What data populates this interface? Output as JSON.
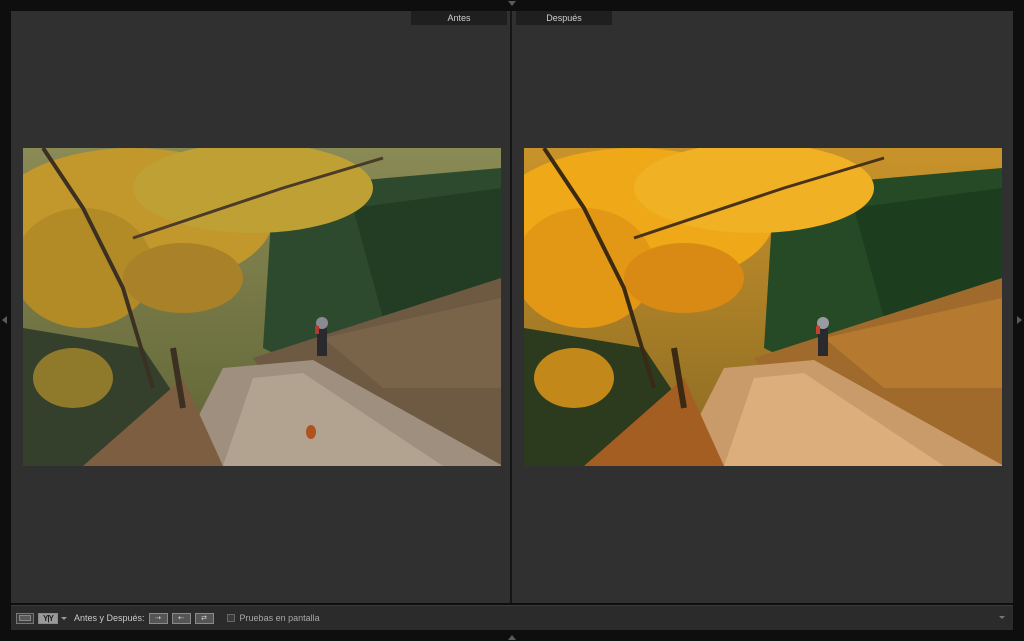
{
  "app": {
    "accent_dark": "#0e0e0e",
    "workspace_color": "#303030"
  },
  "view": {
    "before_label": "Antes",
    "after_label": "Después"
  },
  "photos": {
    "before": {
      "icon": "photo-before-image",
      "tone": "muted"
    },
    "after": {
      "icon": "photo-after-image",
      "tone": "warm-enhanced"
    }
  },
  "toolbar": {
    "loupe_icon": "loupe-view-icon",
    "yy_label": "Y|Y",
    "mode_label": "Antes y Después:",
    "copy_before_to_after": "⇢",
    "copy_after_to_before": "⇠",
    "swap": "⇄",
    "soft_proof_label": "Pruebas en pantalla"
  }
}
